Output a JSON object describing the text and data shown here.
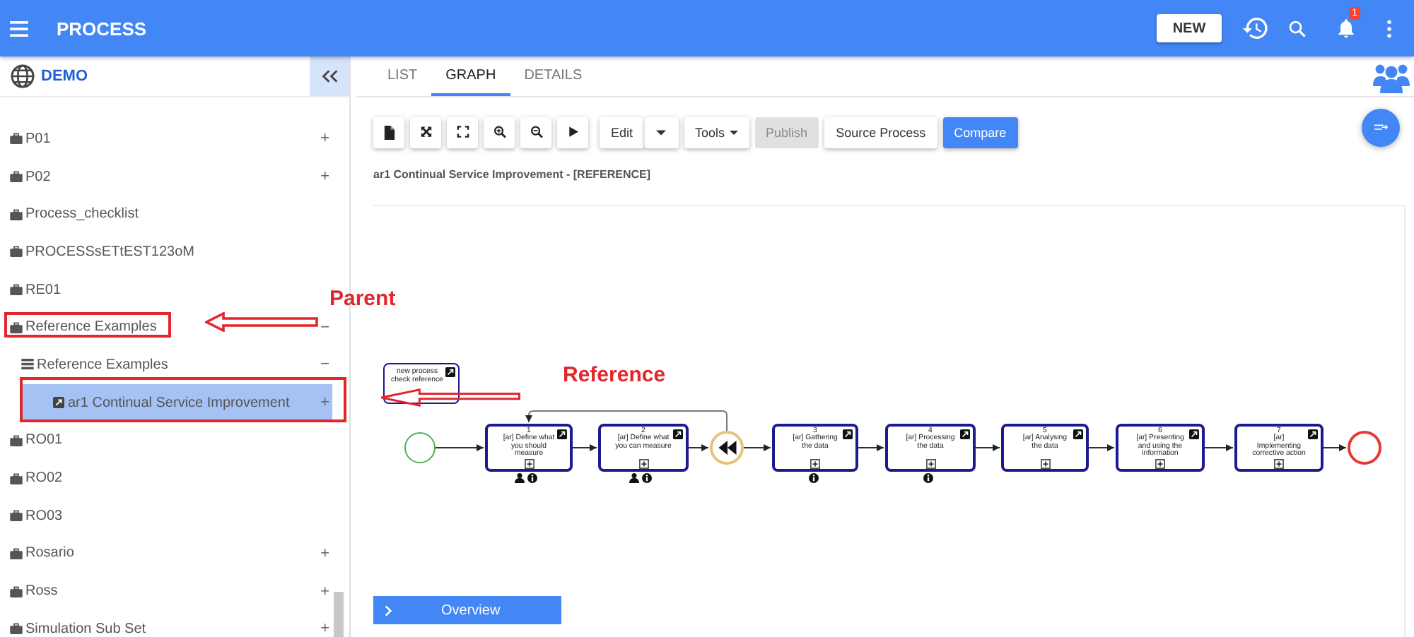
{
  "header": {
    "title": "PROCESS",
    "new_button": "NEW",
    "notification_count": "1"
  },
  "sidebar": {
    "title": "DEMO",
    "items": [
      {
        "label": "P01",
        "kind": "folder",
        "toggle": "+",
        "selected": false
      },
      {
        "label": "P02",
        "kind": "folder",
        "toggle": "+",
        "selected": false
      },
      {
        "label": "Process_checklist",
        "kind": "folder",
        "selected": false
      },
      {
        "label": "PROCESSsETtEST123oM",
        "kind": "folder",
        "selected": false
      },
      {
        "label": "RE01",
        "kind": "folder",
        "selected": false
      },
      {
        "label": "Reference Examples",
        "kind": "folder",
        "toggle": "−",
        "selected": false,
        "children": [
          {
            "label": "Reference Examples",
            "kind": "list",
            "toggle": "−",
            "selected": false,
            "children": [
              {
                "label": "ar1 Continual Service Improvement",
                "kind": "process",
                "toggle": "+",
                "selected": true
              }
            ]
          }
        ]
      },
      {
        "label": "RO01",
        "kind": "folder",
        "selected": false
      },
      {
        "label": "RO02",
        "kind": "folder",
        "selected": false
      },
      {
        "label": "RO03",
        "kind": "folder",
        "selected": false
      },
      {
        "label": "Rosario",
        "kind": "folder",
        "toggle": "+",
        "selected": false
      },
      {
        "label": "Ross",
        "kind": "folder",
        "toggle": "+",
        "selected": false
      },
      {
        "label": "Simulation Sub Set",
        "kind": "folder",
        "toggle": "+",
        "selected": false
      }
    ]
  },
  "tabs": [
    {
      "label": "LIST",
      "selected": false
    },
    {
      "label": "GRAPH",
      "selected": true
    },
    {
      "label": "DETAILS",
      "selected": false
    }
  ],
  "toolbar": {
    "icon_buttons": [
      {
        "kind": "page"
      },
      {
        "kind": "move"
      },
      {
        "kind": "fullscreen"
      },
      {
        "kind": "zoom_in"
      },
      {
        "kind": "zoom_out"
      },
      {
        "kind": "play"
      }
    ],
    "text_buttons": [
      {
        "label": "Edit",
        "kind": "split"
      },
      {
        "label": "Tools",
        "kind": "menu",
        "disabled": false
      },
      {
        "label": "Publish",
        "kind": "plain",
        "disabled": true
      },
      {
        "label": "Source Process",
        "kind": "plain",
        "disabled": false
      },
      {
        "label": "Compare",
        "kind": "primary",
        "disabled": false
      }
    ]
  },
  "diagram": {
    "title": "ar1 Continual Service Improvement - [REFERENCE]",
    "overview": "Overview",
    "nodes": [
      {
        "kind": "note",
        "label": "new process check reference"
      },
      {
        "kind": "start"
      },
      {
        "kind": "task",
        "number": "1",
        "label": "[ar] Define what you should measure",
        "has_performer": true,
        "has_info": true
      },
      {
        "kind": "task",
        "number": "2",
        "label": "[ar] Define what you can measure",
        "has_performer": true,
        "has_info": true
      },
      {
        "kind": "gateway"
      },
      {
        "kind": "task",
        "number": "3",
        "label": "[ar] Gathering the data",
        "has_performer": false,
        "has_info": true
      },
      {
        "kind": "task",
        "number": "4",
        "label": "[ar] Processing the data",
        "has_performer": false,
        "has_info": true
      },
      {
        "kind": "task",
        "number": "5",
        "label": "[ar] Analysing the data",
        "has_performer": false,
        "has_info": false
      },
      {
        "kind": "task",
        "number": "6",
        "label": "[ar] Presenting and using the information",
        "has_performer": false,
        "has_info": false
      },
      {
        "kind": "task",
        "number": "7",
        "label": "[ar] Implementing corrective action",
        "has_performer": false,
        "has_info": false
      },
      {
        "kind": "end"
      }
    ]
  },
  "annotations": {
    "parent_label": "Parent",
    "reference_label": "Reference"
  }
}
